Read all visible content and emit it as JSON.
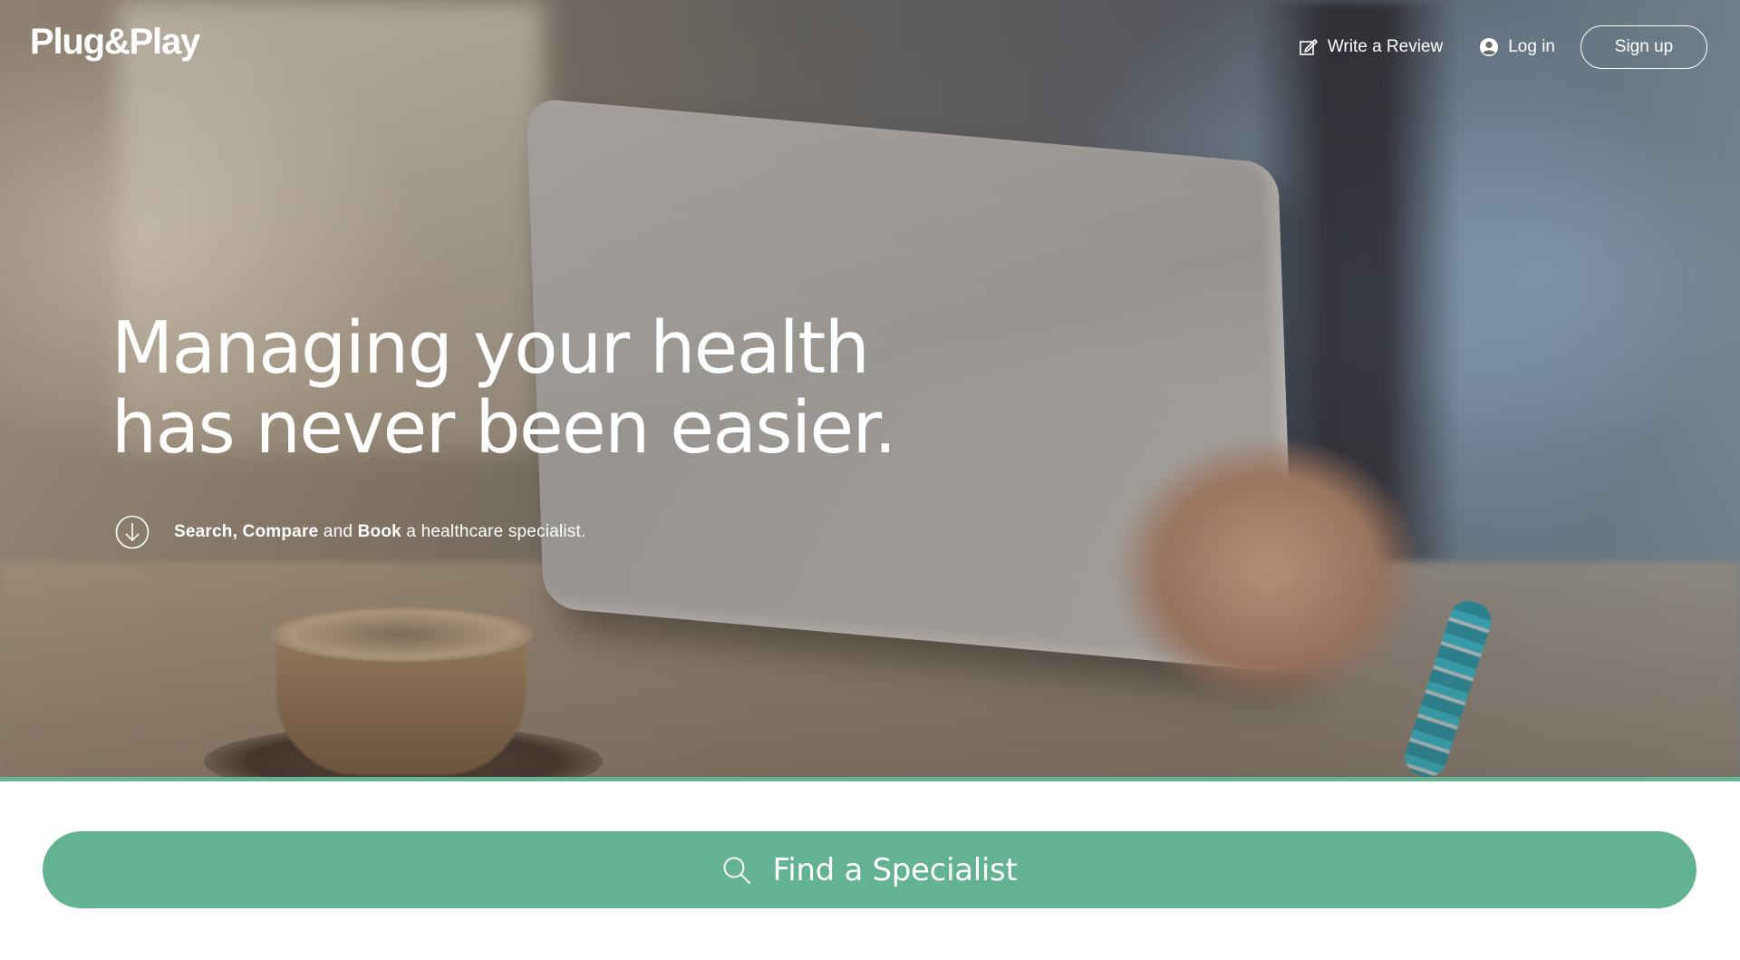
{
  "brand": {
    "logo_text": "Plug&Play",
    "accent_color": "#63b293"
  },
  "nav": {
    "write_review": {
      "label": "Write a Review",
      "icon": "edit-icon"
    },
    "login": {
      "label": "Log in",
      "icon": "user-icon"
    },
    "signup": {
      "label": "Sign up"
    }
  },
  "hero": {
    "headline_line1": "Managing your health",
    "headline_line2": "has never been easier.",
    "tagline": {
      "icon": "arrow-down-circle-icon",
      "word1": "Search,",
      "word2": "Compare",
      "and": "and",
      "word3": "Book",
      "rest": "a healthcare specialist."
    }
  },
  "search": {
    "label": "Find a Specialist",
    "icon": "search-icon"
  }
}
